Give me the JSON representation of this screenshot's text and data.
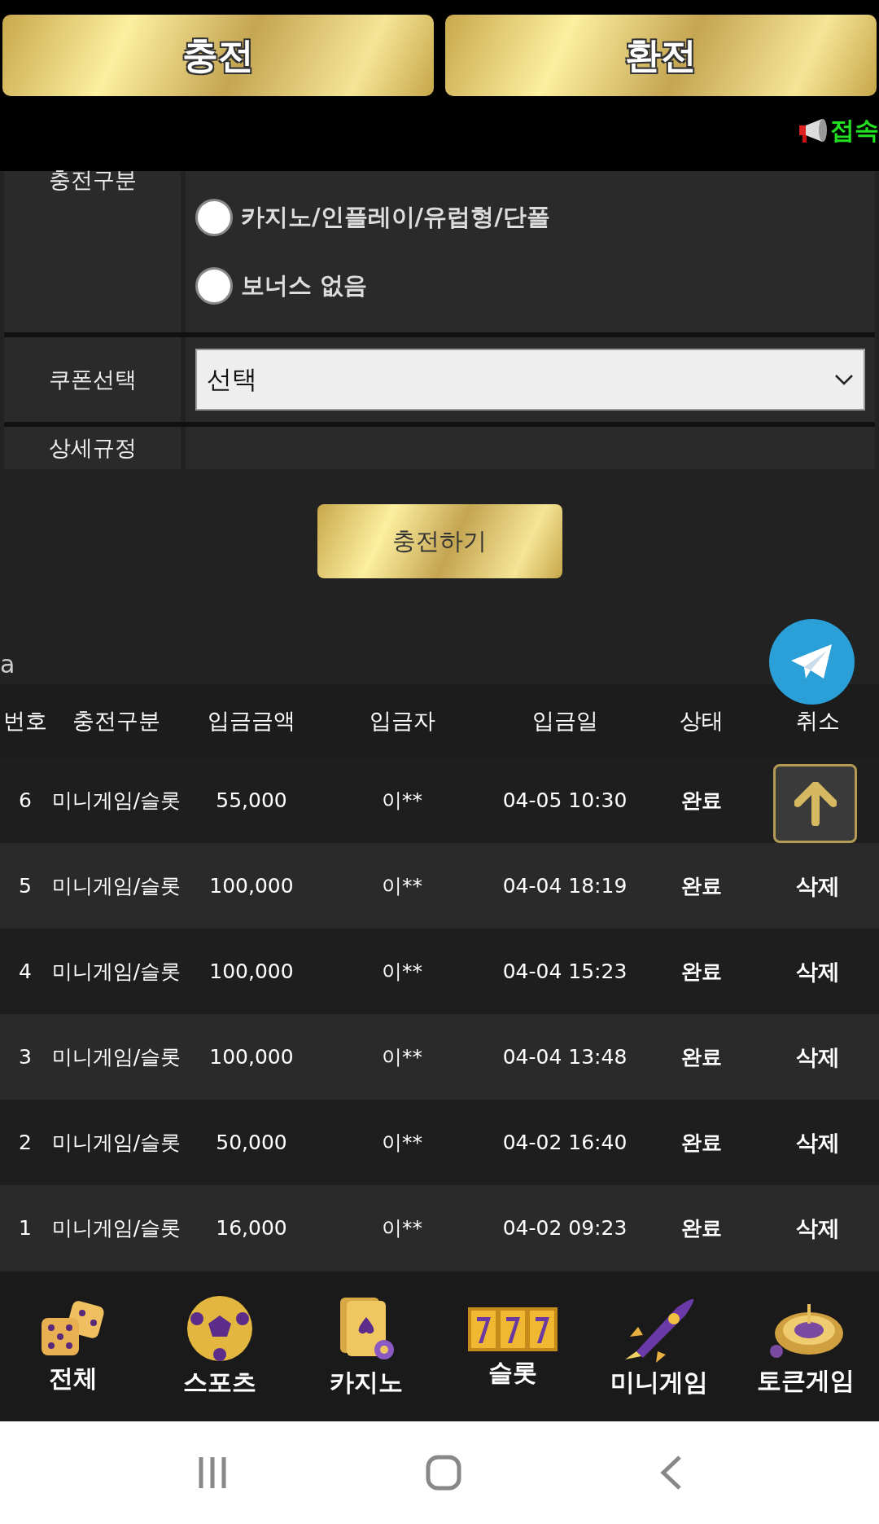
{
  "top_buttons": [
    "충전",
    "환전"
  ],
  "notice": "접속",
  "form": {
    "deposit_type": {
      "label": "충전구분",
      "options": [
        {
          "label": "카지노/인플레이/유럽형/단폴",
          "selected": false
        },
        {
          "label": "보너스 없음",
          "selected": false
        }
      ]
    },
    "coupon": {
      "label": "쿠폰선택",
      "value": "선택"
    },
    "rules": {
      "label": "상세규정"
    }
  },
  "submit": "충전하기",
  "section_label": "a",
  "table": {
    "columns": [
      "번호",
      "충전구분",
      "입금금액",
      "입금자",
      "입금일",
      "상태",
      "취소"
    ],
    "rows": [
      {
        "no": "6",
        "type": "미니게임/슬롯",
        "amount": "55,000",
        "depositor": "이**",
        "date": "04-05 10:30",
        "status": "완료"
      },
      {
        "no": "5",
        "type": "미니게임/슬롯",
        "amount": "100,000",
        "depositor": "이**",
        "date": "04-04 18:19",
        "status": "완료",
        "cancel": "삭제"
      },
      {
        "no": "4",
        "type": "미니게임/슬롯",
        "amount": "100,000",
        "depositor": "이**",
        "date": "04-04 15:23",
        "status": "완료",
        "cancel": "삭제"
      },
      {
        "no": "3",
        "type": "미니게임/슬롯",
        "amount": "100,000",
        "depositor": "이**",
        "date": "04-04 13:48",
        "status": "완료",
        "cancel": "삭제"
      },
      {
        "no": "2",
        "type": "미니게임/슬롯",
        "amount": "50,000",
        "depositor": "이**",
        "date": "04-02 16:40",
        "status": "완료",
        "cancel": "삭제"
      },
      {
        "no": "1",
        "type": "미니게임/슬롯",
        "amount": "16,000",
        "depositor": "이**",
        "date": "04-02 09:23",
        "status": "완료",
        "cancel": "삭제"
      }
    ]
  },
  "bottom_nav": [
    {
      "label": "전체",
      "kind": "dice"
    },
    {
      "label": "스포츠",
      "kind": "ball"
    },
    {
      "label": "카지노",
      "kind": "cards"
    },
    {
      "label": "슬롯",
      "kind": "slot"
    },
    {
      "label": "미니게임",
      "kind": "rocket"
    },
    {
      "label": "토큰게임",
      "kind": "roulette"
    }
  ]
}
